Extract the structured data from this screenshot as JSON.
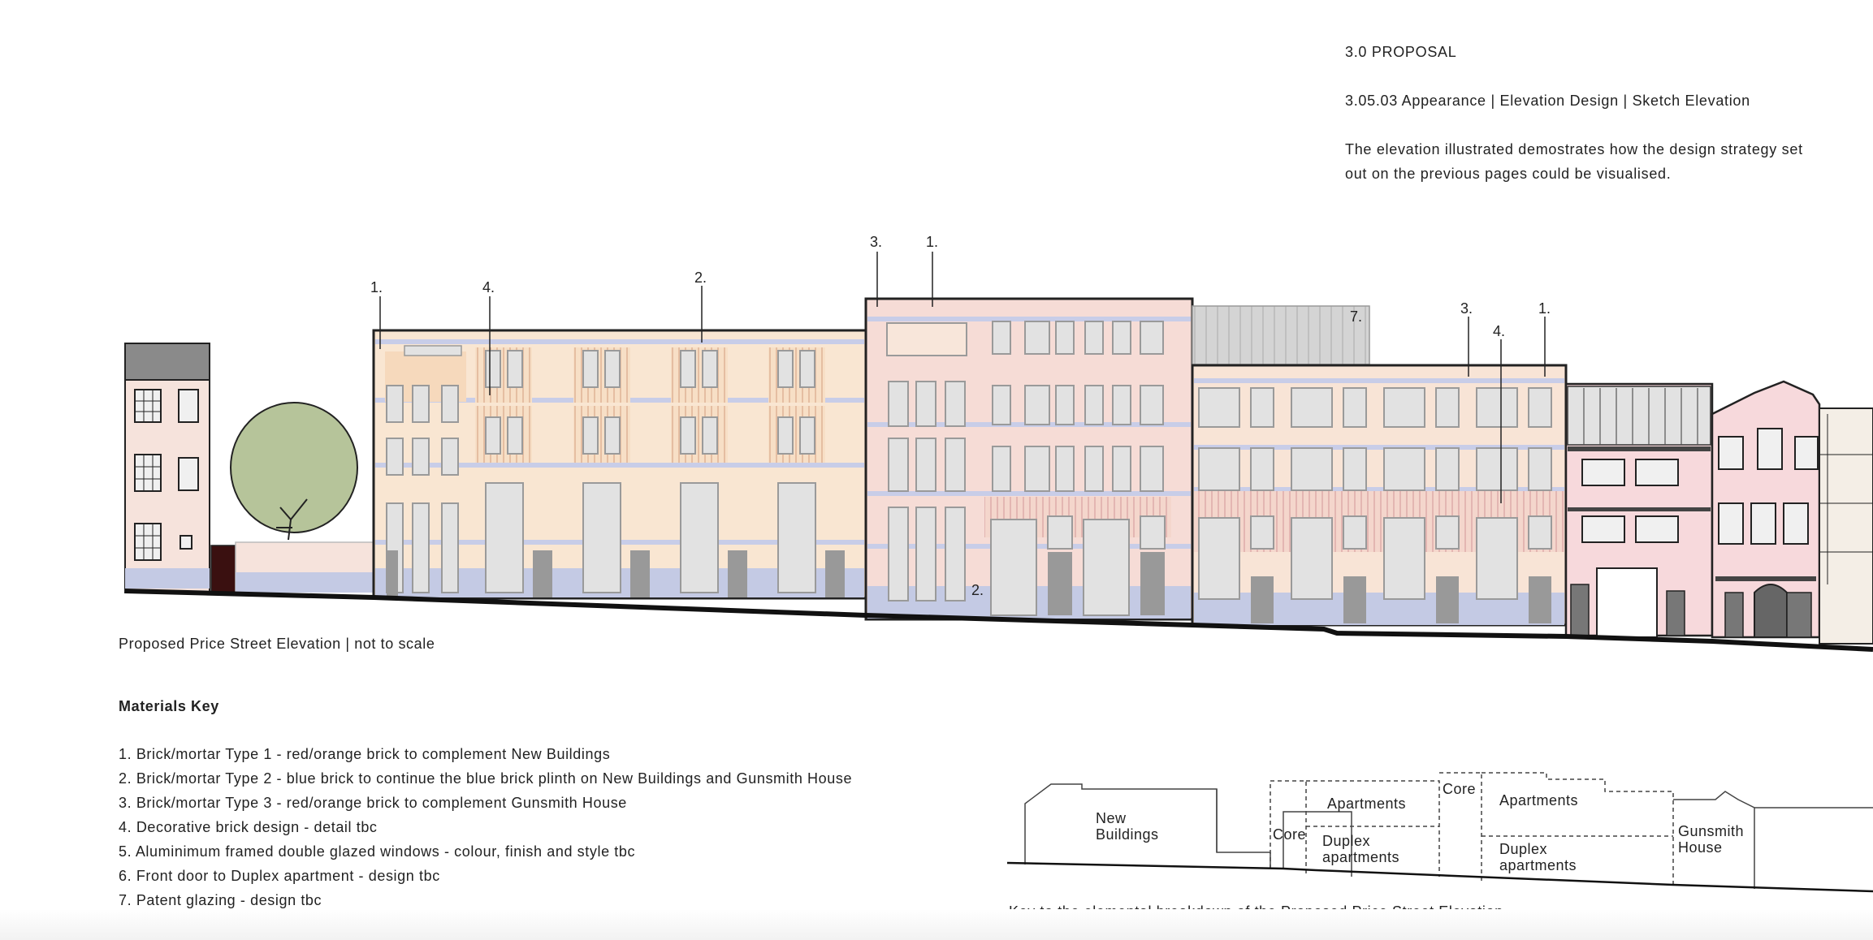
{
  "header": {
    "section": "3.0 PROPOSAL",
    "subsection": "3.05.03  Appearance | Elevation Design | Sketch Elevation",
    "description_line1": "The elevation illustrated demostrates how the design strategy set",
    "description_line2": "out on the previous pages could be visualised."
  },
  "elevation": {
    "caption": "Proposed Price Street Elevation | not to scale",
    "callouts": [
      "1.",
      "4.",
      "2.",
      "3.",
      "1.",
      "2.",
      "7.",
      "3.",
      "4.",
      "1."
    ]
  },
  "materials_key": {
    "title": "Materials Key",
    "items": [
      "1. Brick/mortar Type 1 - red/orange brick to complement New Buildings",
      "2. Brick/mortar Type 2 - blue brick to continue the blue brick plinth on New Buildings and Gunsmith House",
      "3. Brick/mortar Type 3 - red/orange brick to complement Gunsmith House",
      "4. Decorative brick design - detail tbc",
      "5. Aluminimum framed double glazed windows - colour, finish and style tbc",
      "6. Front door to Duplex apartment - design tbc",
      "7. Patent glazing - design tbc"
    ]
  },
  "breakdown": {
    "new_buildings_line1": "New",
    "new_buildings_line2": "Buildings",
    "core_left": "Core",
    "apartments_left": "Apartments",
    "duplex_left_line1": "Duplex",
    "duplex_left_line2": "apartments",
    "core_right": "Core",
    "apartments_right": "Apartments",
    "duplex_right_line1": "Duplex",
    "duplex_right_line2": "apartments",
    "gunsmith_line1": "Gunsmith",
    "gunsmith_line2": "House",
    "caption": "Key to the elemental breakdown of the Proposed Price Street Elevation"
  },
  "colors": {
    "brick_orange": "#f8e2cc",
    "brick_pink": "#f5dcd4",
    "blue_plinth": "#c4cae4",
    "window": "#e2e2e2",
    "door": "#999999",
    "tree": "#b6c49a",
    "roof_grey": "#c8c8c8"
  }
}
